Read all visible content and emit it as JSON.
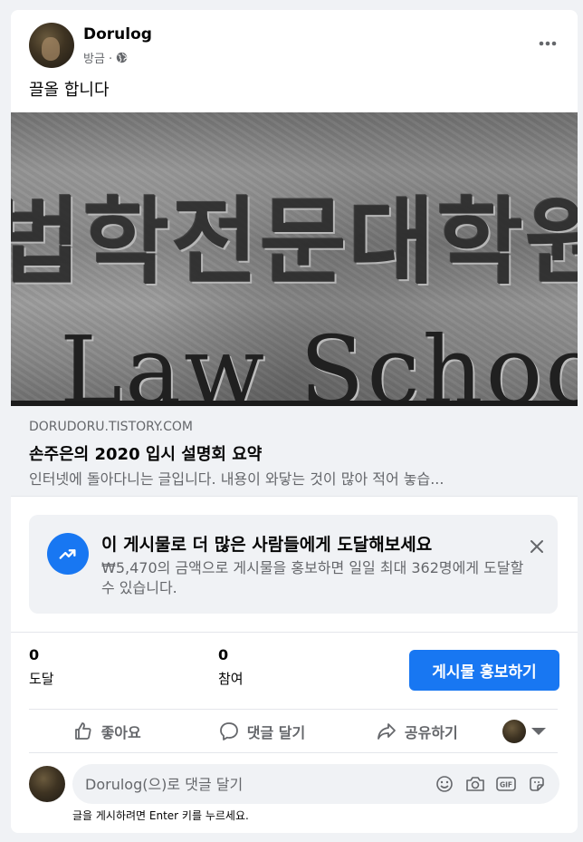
{
  "post": {
    "author": "Dorulog",
    "time": "방금 ·",
    "text": "끌올 합니다"
  },
  "image": {
    "korean_text": "법학전문대학원",
    "english_text": "Law School"
  },
  "link": {
    "domain": "DORUDORU.TISTORY.COM",
    "title": "손주은의 2020 입시 설명회 요약",
    "description": "인터넷에 돌아다니는 글입니다. 내용이 와닿는 것이 많아 적어 놓습..."
  },
  "promo": {
    "title": "이 게시물로 더 많은 사람들에게 도달해보세요",
    "description": "₩5,470의 금액으로 게시물을 홍보하면 일일 최대 362명에게 도달할 수 있습니다."
  },
  "stats": {
    "reach_value": "0",
    "reach_label": "도달",
    "engagement_value": "0",
    "engagement_label": "참여",
    "boost_label": "게시물 홍보하기"
  },
  "actions": {
    "like": "좋아요",
    "comment": "댓글 달기",
    "share": "공유하기"
  },
  "comment": {
    "placeholder": "Dorulog(으)로 댓글 달기",
    "hint": "글을 게시하려면 Enter 키를 누르세요."
  },
  "colors": {
    "accent": "#1877f2",
    "secondary_text": "#65676b",
    "background": "#f0f2f5"
  },
  "icons": [
    "globe-icon",
    "more-icon",
    "trending-up-icon",
    "close-icon",
    "like-icon",
    "comment-icon",
    "share-icon",
    "chevron-down-icon",
    "emoji-icon",
    "camera-icon",
    "gif-icon",
    "sticker-icon"
  ]
}
